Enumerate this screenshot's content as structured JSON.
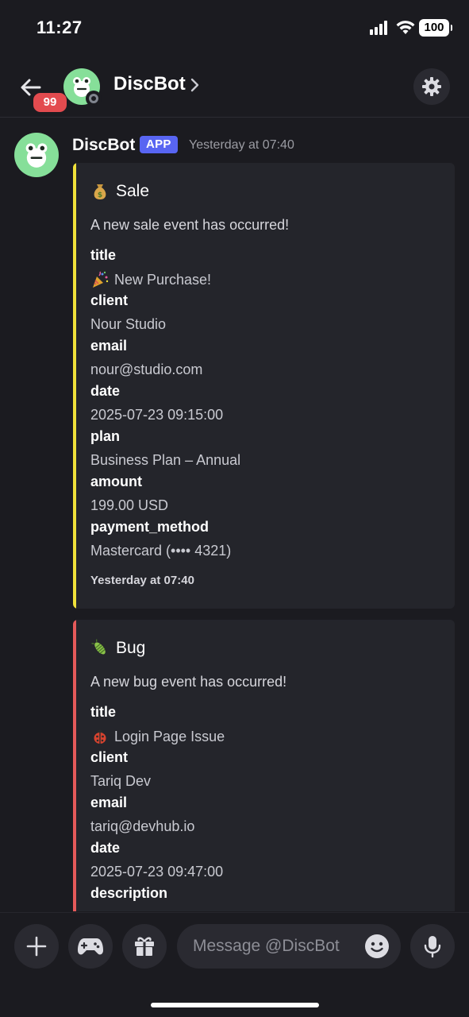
{
  "status_bar": {
    "time": "11:27",
    "battery": "100"
  },
  "header": {
    "title": "DiscBot",
    "unread_badge": "99"
  },
  "message": {
    "author": "DiscBot",
    "app_tag": "APP",
    "timestamp": "Yesterday at 07:40",
    "embeds": [
      {
        "title": "Sale",
        "title_icon": "money-bag-icon",
        "accent": "#f0e13a",
        "description": "A new sale event has occurred!",
        "fields": [
          {
            "name": "title",
            "value": "New Purchase!",
            "value_icon": "party-popper-icon"
          },
          {
            "name": "client",
            "value": "Nour Studio"
          },
          {
            "name": "email",
            "value": "nour@studio.com"
          },
          {
            "name": "date",
            "value": "2025-07-23 09:15:00"
          },
          {
            "name": "plan",
            "value": "Business Plan – Annual"
          },
          {
            "name": "amount",
            "value": "199.00 USD"
          },
          {
            "name": "payment_method",
            "value": "Mastercard (•••• 4321)"
          }
        ],
        "footer": "Yesterday at 07:40"
      },
      {
        "title": "Bug",
        "title_icon": "bug-icon",
        "accent": "#e55a5a",
        "description": "A new bug event has occurred!",
        "fields": [
          {
            "name": "title",
            "value": "Login Page Issue",
            "value_icon": "ladybug-icon"
          },
          {
            "name": "client",
            "value": "Tariq Dev"
          },
          {
            "name": "email",
            "value": "tariq@devhub.io"
          },
          {
            "name": "date",
            "value": "2025-07-23 09:47:00"
          },
          {
            "name": "description",
            "value": ""
          }
        ]
      }
    ]
  },
  "composer": {
    "placeholder": "Message @DiscBot"
  }
}
